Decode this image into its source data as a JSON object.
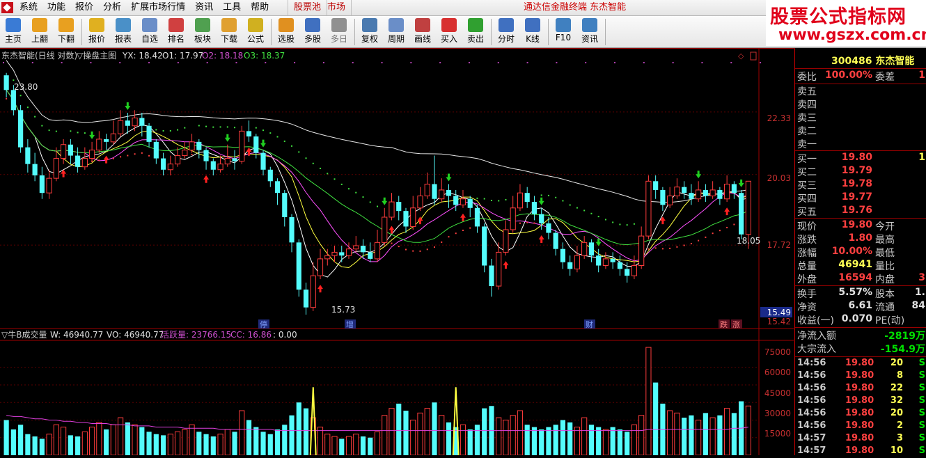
{
  "menubar": {
    "items": [
      "系统",
      "功能",
      "报价",
      "分析",
      "扩展市场行情",
      "资讯",
      "工具",
      "帮助"
    ],
    "tab_stock_pool": "股票池",
    "tab_market": "市场",
    "window_title": "通达信金融终端  东杰智能"
  },
  "watermark": {
    "line1": "股票公式指标网",
    "line2": "www.gszx.com.cn"
  },
  "toolbar": [
    {
      "label": "主页",
      "icon": "home-icon",
      "color": "#3a7bd5"
    },
    {
      "label": "上翻",
      "icon": "arrow-up-icon",
      "color": "#e8a020"
    },
    {
      "label": "下翻",
      "icon": "arrow-down-icon",
      "color": "#e8a020"
    },
    {
      "label": "报价",
      "icon": "yuan-icon",
      "color": "#e0b020"
    },
    {
      "label": "报表",
      "icon": "report-icon",
      "color": "#4a90c8"
    },
    {
      "label": "自选",
      "icon": "f6-icon",
      "color": "#6a8ec8"
    },
    {
      "label": "排名",
      "icon": "ranking-icon",
      "color": "#d04040"
    },
    {
      "label": "板块",
      "icon": "blocks-icon",
      "color": "#50a050"
    },
    {
      "label": "下载",
      "icon": "download-icon",
      "color": "#e0a030"
    },
    {
      "label": "公式",
      "icon": "formula-icon",
      "color": "#d0b020"
    },
    {
      "label": "选股",
      "icon": "stock-pick-icon",
      "color": "#e09020"
    },
    {
      "label": "多股",
      "icon": "multi-stock-icon",
      "color": "#4070c0"
    },
    {
      "label": "多日",
      "icon": "clock-icon",
      "color": "#909090"
    },
    {
      "label": "复权",
      "icon": "adjust-icon",
      "color": "#4a7ab0"
    },
    {
      "label": "周期",
      "icon": "f8-icon",
      "color": "#6a8ec8"
    },
    {
      "label": "画线",
      "icon": "draw-line-icon",
      "color": "#c04040"
    },
    {
      "label": "买入",
      "icon": "buy-icon",
      "color": "#d83030"
    },
    {
      "label": "卖出",
      "icon": "sell-icon",
      "color": "#30a030"
    },
    {
      "label": "分时",
      "icon": "intraday-icon",
      "color": "#4070c0"
    },
    {
      "label": "K线",
      "icon": "kline-icon",
      "color": "#4070c0"
    },
    {
      "label": "F10",
      "icon": "f10-icon",
      "color": "#4080c0"
    },
    {
      "label": "资讯",
      "icon": "news-icon",
      "color": "#4080c0"
    }
  ],
  "main_chart": {
    "header": {
      "name": "东杰智能(日线 对数)",
      "indicator": "▽操盘主图",
      "yx_label": "YX: 18.42",
      "o1_label": "O1: 17.97",
      "o2_label": "O2: 18.18",
      "o3_label": "O3: 18.37"
    },
    "y_ticks": [
      "22.33",
      "20.03",
      "17.72",
      "15.42"
    ],
    "current_price_tag": "15.49",
    "high_label": "23.80",
    "low_label": "15.73",
    "last_label": "18.05",
    "event_tags": [
      "停",
      "增",
      "财",
      "跌",
      "涨"
    ]
  },
  "sub_chart": {
    "header": {
      "name": "▽牛B成交量",
      "w_label": "W: 46940.77",
      "vo_label": "VO: 46940.77",
      "active_label": "活跃量: 23766.15",
      "cc_label": "CC: 16.86",
      "extra_label": ": 0.00"
    },
    "y_ticks": [
      "75000",
      "60000",
      "45000",
      "30000",
      "15000"
    ]
  },
  "chart_data": {
    "type": "candlestick",
    "title": "东杰智能(日线 对数)",
    "ylim": [
      15.42,
      24.3
    ],
    "candles": [
      [
        23.8,
        23.2,
        23.9,
        22.9
      ],
      [
        23.2,
        22.4,
        23.4,
        22.2
      ],
      [
        22.4,
        21.0,
        22.6,
        20.8
      ],
      [
        21.0,
        20.4,
        21.3,
        20.1
      ],
      [
        20.4,
        20.0,
        20.8,
        19.8
      ],
      [
        20.0,
        19.4,
        20.3,
        19.2
      ],
      [
        19.4,
        19.9,
        20.2,
        19.2
      ],
      [
        19.9,
        20.6,
        21.0,
        19.8
      ],
      [
        20.6,
        21.1,
        21.3,
        20.4
      ],
      [
        21.1,
        20.7,
        21.3,
        20.4
      ],
      [
        20.7,
        20.3,
        21.0,
        20.1
      ],
      [
        20.3,
        20.6,
        21.0,
        20.2
      ],
      [
        20.6,
        20.9,
        21.2,
        20.5
      ],
      [
        20.9,
        21.3,
        21.6,
        20.8
      ],
      [
        21.3,
        21.2,
        21.5,
        20.9
      ],
      [
        21.2,
        21.5,
        22.0,
        21.1
      ],
      [
        21.5,
        22.0,
        22.4,
        21.4
      ],
      [
        22.0,
        21.8,
        22.3,
        21.5
      ],
      [
        21.8,
        22.1,
        22.4,
        21.6
      ],
      [
        22.1,
        21.8,
        22.3,
        21.4
      ],
      [
        21.8,
        21.2,
        21.9,
        21.0
      ],
      [
        21.2,
        20.6,
        21.3,
        20.4
      ],
      [
        20.6,
        20.2,
        20.8,
        20.0
      ],
      [
        20.2,
        20.4,
        20.7,
        20.0
      ],
      [
        20.4,
        20.7,
        21.0,
        20.3
      ],
      [
        20.7,
        20.9,
        21.2,
        20.6
      ],
      [
        20.9,
        21.2,
        21.5,
        20.8
      ],
      [
        21.2,
        20.9,
        21.3,
        20.6
      ],
      [
        20.9,
        20.5,
        21.0,
        20.2
      ],
      [
        20.5,
        20.2,
        20.6,
        20.0
      ],
      [
        20.2,
        20.4,
        20.7,
        20.1
      ],
      [
        20.4,
        20.6,
        21.1,
        20.3
      ],
      [
        20.6,
        20.5,
        20.9,
        20.2
      ],
      [
        20.5,
        21.6,
        21.8,
        20.4
      ],
      [
        21.6,
        21.4,
        22.0,
        21.2
      ],
      [
        21.4,
        20.8,
        21.5,
        20.6
      ],
      [
        20.8,
        20.2,
        20.9,
        20.0
      ],
      [
        20.2,
        19.8,
        20.3,
        19.6
      ],
      [
        19.8,
        19.4,
        19.9,
        19.0
      ],
      [
        19.4,
        18.6,
        19.5,
        18.3
      ],
      [
        18.6,
        17.8,
        18.7,
        17.5
      ],
      [
        17.8,
        16.4,
        17.9,
        16.2
      ],
      [
        16.4,
        15.9,
        16.6,
        15.7
      ],
      [
        15.9,
        16.8,
        17.2,
        15.8
      ],
      [
        16.8,
        17.3,
        17.6,
        16.7
      ],
      [
        17.3,
        17.4,
        17.6,
        17.1
      ],
      [
        17.4,
        17.5,
        17.7,
        17.2
      ],
      [
        17.5,
        17.4,
        17.7,
        17.2
      ],
      [
        17.4,
        17.6,
        17.8,
        17.3
      ],
      [
        17.6,
        17.7,
        18.0,
        17.5
      ],
      [
        17.7,
        17.5,
        17.9,
        17.3
      ],
      [
        17.5,
        17.3,
        17.8,
        17.2
      ],
      [
        17.3,
        17.8,
        18.2,
        17.2
      ],
      [
        17.8,
        18.6,
        18.9,
        17.7
      ],
      [
        18.6,
        19.1,
        19.4,
        18.5
      ],
      [
        19.1,
        18.8,
        19.3,
        18.5
      ],
      [
        18.8,
        18.3,
        18.9,
        18.1
      ],
      [
        18.3,
        18.9,
        19.3,
        18.2
      ],
      [
        18.9,
        19.3,
        19.6,
        18.8
      ],
      [
        19.3,
        19.7,
        20.1,
        19.2
      ],
      [
        19.7,
        19.2,
        20.7,
        19.0
      ],
      [
        19.2,
        19.5,
        19.9,
        19.1
      ],
      [
        19.5,
        19.3,
        19.7,
        18.9
      ],
      [
        19.3,
        19.0,
        19.5,
        18.8
      ],
      [
        19.0,
        19.2,
        19.5,
        18.9
      ],
      [
        19.2,
        18.9,
        19.3,
        18.6
      ],
      [
        18.9,
        18.3,
        19.0,
        18.1
      ],
      [
        18.3,
        17.1,
        18.4,
        16.9
      ],
      [
        17.1,
        16.5,
        17.3,
        16.2
      ],
      [
        16.5,
        17.5,
        17.8,
        16.4
      ],
      [
        17.5,
        18.2,
        18.5,
        17.4
      ],
      [
        18.2,
        18.9,
        19.3,
        18.1
      ],
      [
        18.9,
        19.4,
        19.7,
        18.8
      ],
      [
        19.4,
        19.1,
        19.6,
        18.9
      ],
      [
        19.1,
        18.7,
        19.3,
        18.5
      ],
      [
        18.7,
        18.4,
        18.9,
        18.2
      ],
      [
        18.4,
        18.1,
        18.6,
        17.9
      ],
      [
        18.1,
        17.6,
        18.2,
        17.4
      ],
      [
        17.6,
        17.2,
        17.8,
        17.0
      ],
      [
        17.2,
        17.0,
        17.4,
        16.8
      ],
      [
        17.0,
        17.4,
        17.7,
        16.9
      ],
      [
        17.4,
        17.8,
        18.0,
        17.3
      ],
      [
        17.8,
        17.4,
        17.9,
        17.2
      ],
      [
        17.4,
        17.1,
        17.6,
        16.9
      ],
      [
        17.1,
        17.3,
        17.5,
        17.0
      ],
      [
        17.3,
        17.2,
        17.5,
        17.0
      ],
      [
        17.2,
        17.0,
        17.4,
        16.8
      ],
      [
        17.0,
        16.8,
        17.2,
        16.6
      ],
      [
        16.8,
        17.1,
        17.4,
        16.7
      ],
      [
        17.1,
        18.0,
        18.3,
        17.0
      ],
      [
        18.0,
        19.8,
        20.0,
        17.9
      ],
      [
        19.8,
        19.5,
        20.0,
        19.2
      ],
      [
        19.5,
        19.0,
        19.6,
        18.8
      ],
      [
        19.0,
        19.3,
        19.6,
        18.9
      ],
      [
        19.3,
        19.6,
        19.9,
        19.2
      ],
      [
        19.6,
        19.4,
        19.8,
        19.2
      ],
      [
        19.4,
        19.2,
        19.7,
        19.0
      ],
      [
        19.2,
        19.5,
        19.8,
        19.1
      ],
      [
        19.5,
        19.3,
        19.7,
        19.1
      ],
      [
        19.3,
        19.5,
        19.8,
        19.2
      ],
      [
        19.5,
        19.2,
        19.6,
        19.0
      ],
      [
        19.2,
        19.7,
        20.0,
        19.1
      ],
      [
        19.7,
        19.4,
        19.8,
        19.2
      ],
      [
        19.4,
        18.05,
        19.5,
        17.9
      ],
      [
        18.05,
        19.8,
        19.8,
        17.6
      ]
    ],
    "volumes": [
      30,
      22,
      26,
      18,
      16,
      14,
      18,
      26,
      24,
      17,
      16,
      20,
      24,
      28,
      22,
      26,
      32,
      28,
      26,
      24,
      20,
      18,
      17,
      18,
      20,
      22,
      26,
      20,
      18,
      16,
      18,
      22,
      20,
      38,
      30,
      24,
      20,
      18,
      22,
      26,
      34,
      45,
      40,
      32,
      24,
      18,
      16,
      14,
      16,
      18,
      16,
      15,
      20,
      34,
      40,
      44,
      38,
      30,
      36,
      40,
      45,
      34,
      28,
      24,
      26,
      22,
      26,
      40,
      42,
      32,
      30,
      34,
      38,
      26,
      24,
      22,
      24,
      26,
      30,
      28,
      24,
      32,
      26,
      24,
      22,
      24,
      22,
      20,
      26,
      34,
      92,
      62,
      44,
      38,
      36,
      32,
      34,
      30,
      36,
      32,
      34,
      40,
      36,
      46,
      42
    ],
    "active_volume": [
      34,
      33,
      33,
      32,
      31,
      31,
      30,
      30,
      29,
      29,
      28,
      28,
      27,
      27,
      27,
      26,
      26,
      26,
      25,
      25,
      25,
      24,
      24,
      24,
      24,
      23,
      23,
      23,
      23,
      23,
      22,
      22,
      22,
      22,
      22,
      22,
      22,
      22,
      21,
      21,
      21,
      21,
      21,
      21,
      21,
      21,
      21,
      21,
      21,
      21,
      21,
      21,
      21,
      21,
      21,
      21,
      21,
      21,
      21,
      21,
      21,
      21,
      21,
      21,
      21,
      21,
      21,
      21,
      21,
      21,
      21,
      21,
      21,
      21,
      21,
      21,
      21,
      21,
      21,
      21,
      21,
      21,
      21,
      21,
      21,
      21,
      21,
      21,
      21,
      21,
      22,
      22,
      22,
      22,
      22,
      22,
      22,
      22,
      22,
      22,
      22,
      22,
      23,
      23,
      24
    ]
  },
  "side_panel": {
    "code_name": "300486 东杰智能",
    "weibi_label": "委比",
    "weibi_value": "100.00%",
    "weicha_label": "委差",
    "weicha_value": "1",
    "asks": [
      {
        "label": "卖五"
      },
      {
        "label": "卖四"
      },
      {
        "label": "卖三"
      },
      {
        "label": "卖二"
      },
      {
        "label": "卖一"
      }
    ],
    "bids": [
      {
        "label": "买一",
        "price": "19.80",
        "vol": "1"
      },
      {
        "label": "买二",
        "price": "19.79",
        "vol": ""
      },
      {
        "label": "买三",
        "price": "19.78",
        "vol": ""
      },
      {
        "label": "买四",
        "price": "19.77",
        "vol": ""
      },
      {
        "label": "买五",
        "price": "19.76",
        "vol": ""
      }
    ],
    "stats": [
      {
        "l1": "现价",
        "v1": "19.80",
        "c1": "#ff4040",
        "l2": "今开",
        "v2": ""
      },
      {
        "l1": "涨跌",
        "v1": "1.80",
        "c1": "#ff4040",
        "l2": "最高",
        "v2": ""
      },
      {
        "l1": "涨幅",
        "v1": "10.00%",
        "c1": "#ff4040",
        "l2": "最低",
        "v2": ""
      },
      {
        "l1": "总量",
        "v1": "46941",
        "c1": "#ffff54",
        "l2": "量比",
        "v2": ""
      },
      {
        "l1": "外盘",
        "v1": "16594",
        "c1": "#ff4040",
        "l2": "内盘",
        "v2": "3"
      }
    ],
    "stats2": [
      {
        "l1": "换手",
        "v1": "5.57%",
        "c1": "#e0e0e0",
        "l2": "股本",
        "v2": "1."
      },
      {
        "l1": "净资",
        "v1": "6.61",
        "c1": "#e0e0e0",
        "l2": "流通",
        "v2": "84"
      },
      {
        "l1": "收益(一)",
        "v1": "0.070",
        "c1": "#e0e0e0",
        "l2": "PE(动)",
        "v2": ""
      }
    ],
    "flow": [
      {
        "label": "净流入额",
        "value": "-2819万"
      },
      {
        "label": "大宗流入",
        "value": "-154.9万"
      }
    ],
    "ticks": [
      {
        "time": "14:56",
        "price": "19.80",
        "vol": "20",
        "side": "S"
      },
      {
        "time": "14:56",
        "price": "19.80",
        "vol": "8",
        "side": "S"
      },
      {
        "time": "14:56",
        "price": "19.80",
        "vol": "22",
        "side": "S"
      },
      {
        "time": "14:56",
        "price": "19.80",
        "vol": "32",
        "side": "S"
      },
      {
        "time": "14:56",
        "price": "19.80",
        "vol": "20",
        "side": "S"
      },
      {
        "time": "14:56",
        "price": "19.80",
        "vol": "2",
        "side": "S"
      },
      {
        "time": "14:57",
        "price": "19.80",
        "vol": "3",
        "side": "S"
      },
      {
        "time": "14:57",
        "price": "19.80",
        "vol": "10",
        "side": "S"
      }
    ]
  }
}
